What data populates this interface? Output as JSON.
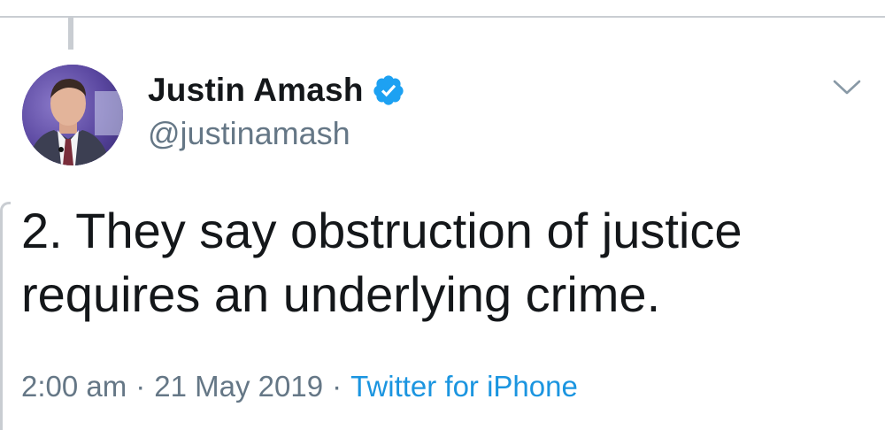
{
  "tweet": {
    "author": {
      "display_name": "Justin Amash",
      "handle": "@justinamash",
      "verified": true
    },
    "text_lines": [
      "2. They say obstruction of justice",
      "requires an underlying crime."
    ],
    "time": "2:00 am",
    "separator": "·",
    "date": "21 May 2019",
    "source": "Twitter for iPhone"
  },
  "icons": {
    "verified": "verified-badge-icon",
    "menu": "chevron-down-icon"
  },
  "colors": {
    "text_primary": "#14171a",
    "text_secondary": "#657786",
    "link": "#1b95e0",
    "verified_badge": "#1da1f2",
    "divider": "#c9cdd2"
  }
}
